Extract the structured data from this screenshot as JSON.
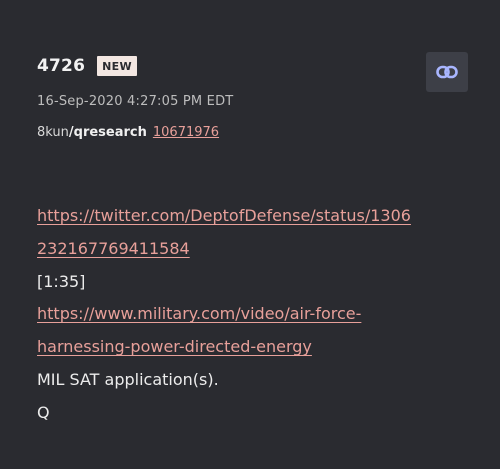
{
  "post": {
    "number": "4726",
    "badge": "NEW",
    "timestamp": "16-Sep-2020 4:27:05 PM EDT",
    "source": {
      "site": "8kun",
      "board": "/qresearch",
      "post_id": "10671976"
    },
    "body": {
      "link1_part1": "https://twitter.com/DeptofDefense/status/1306",
      "link1_part2": "232167769411584",
      "timecode": "[1:35]",
      "link2_part1": "https://www.military.com/video/air-force-",
      "link2_part2": "harnessing-power-directed-energy",
      "text_line": "MIL SAT application(s).",
      "signature": "Q"
    },
    "icons": {
      "permalink": "link-icon"
    },
    "colors": {
      "background": "#2a2b30",
      "link": "#e8a09a",
      "badge_bg": "#f3e7e2",
      "button_bg": "#3d3f47",
      "icon": "#a9b6ff"
    }
  }
}
